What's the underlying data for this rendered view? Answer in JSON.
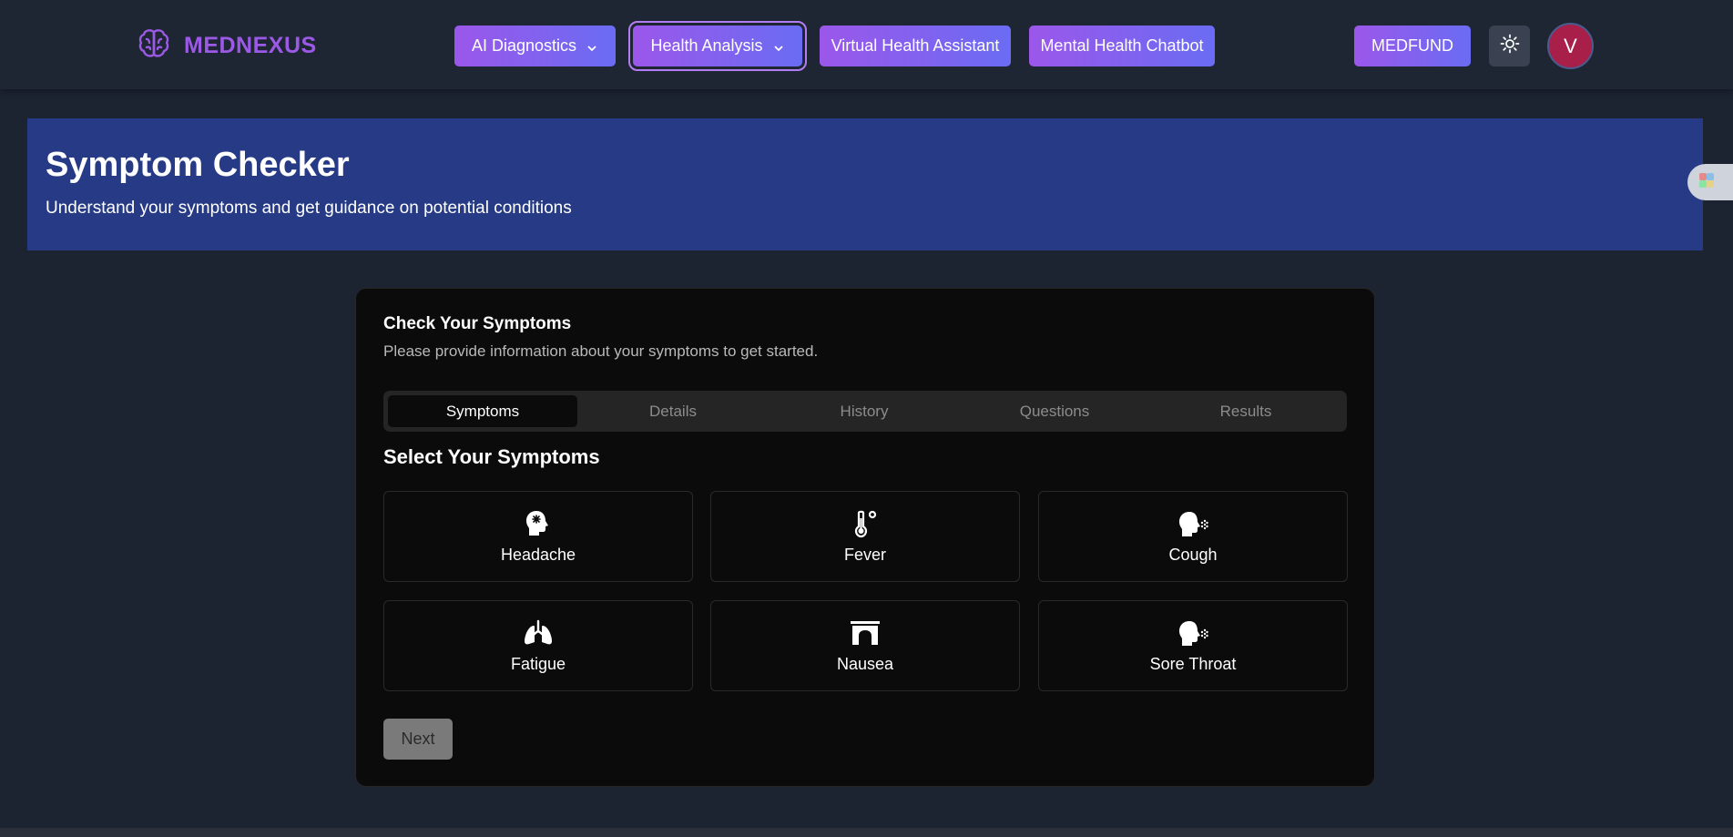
{
  "brand": {
    "name": "MEDNEXUS",
    "icon": "brain-icon"
  },
  "nav": {
    "ai_diagnostics": "AI Diagnostics",
    "health_analysis": "Health Analysis",
    "virtual_assistant": "Virtual Health Assistant",
    "mental_chatbot": "Mental Health Chatbot",
    "medfund": "MEDFUND"
  },
  "user": {
    "avatar_initial": "V"
  },
  "hero": {
    "title": "Symptom Checker",
    "subtitle": "Understand your symptoms and get guidance on potential conditions"
  },
  "card": {
    "title": "Check Your Symptoms",
    "description": "Please provide information about your symptoms to get started.",
    "tabs": [
      "Symptoms",
      "Details",
      "History",
      "Questions",
      "Results"
    ],
    "active_tab": "Symptoms",
    "section_title": "Select Your Symptoms",
    "symptoms": [
      {
        "label": "Headache",
        "icon": "head-pain-icon"
      },
      {
        "label": "Fever",
        "icon": "thermometer-icon"
      },
      {
        "label": "Cough",
        "icon": "head-cough-icon"
      },
      {
        "label": "Fatigue",
        "icon": "lungs-icon"
      },
      {
        "label": "Nausea",
        "icon": "archway-icon"
      },
      {
        "label": "Sore Throat",
        "icon": "head-cough-icon"
      }
    ],
    "next_label": "Next"
  },
  "colors": {
    "brand": "#9b59e6",
    "nav_gradient_start": "#9b57ea",
    "nav_gradient_end": "#6a6cf3",
    "hero_bg": "#263a85",
    "avatar_bg": "#a8204a"
  }
}
